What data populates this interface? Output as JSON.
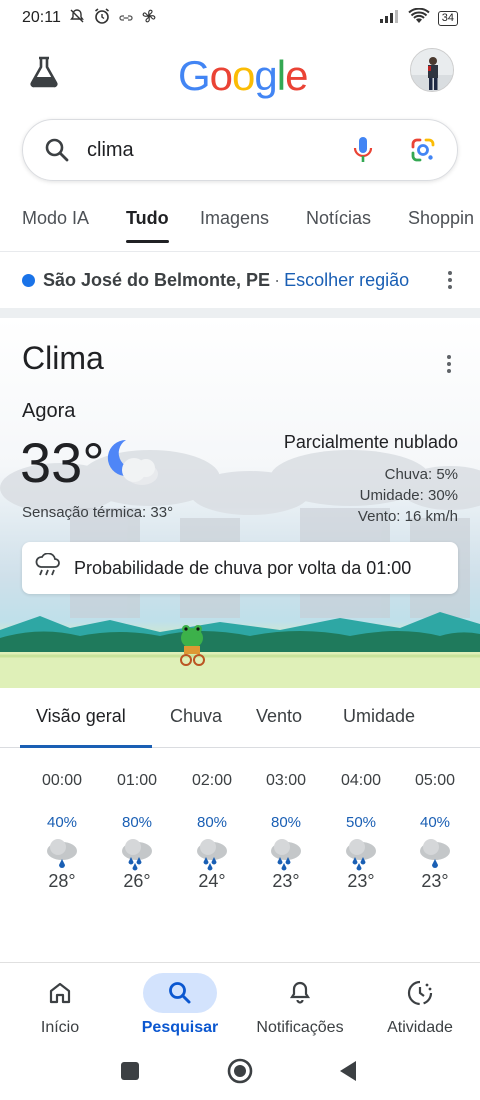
{
  "status_bar": {
    "time": "20:11",
    "battery": "34",
    "left_icons": [
      "bell-off-icon",
      "alarm-icon",
      "link-icon",
      "fan-icon"
    ],
    "right_icons": [
      "signal-icon",
      "wifi-icon",
      "battery-icon"
    ]
  },
  "header": {
    "logo_text": "Google",
    "logo_colors": [
      "#4285F4",
      "#EA4335",
      "#FBBC05",
      "#4285F4",
      "#34A853",
      "#EA4335"
    ]
  },
  "search": {
    "query": "clima"
  },
  "tabs": [
    {
      "label": "Modo IA",
      "active": false
    },
    {
      "label": "Tudo",
      "active": true
    },
    {
      "label": "Imagens",
      "active": false
    },
    {
      "label": "Notícias",
      "active": false
    },
    {
      "label": "Shoppin",
      "active": false
    }
  ],
  "location": {
    "name": "São José do Belmonte, PE",
    "separator": "·",
    "link": "Escolher região"
  },
  "weather": {
    "title": "Clima",
    "now_label": "Agora",
    "temperature": "33°",
    "feels_like": "Sensação térmica: 33°",
    "condition": "Parcialmente nublado",
    "rain": "Chuva: 5%",
    "humidity": "Umidade: 30%",
    "wind": "Vento: 16 km/h",
    "rain_banner": "Probabilidade de chuva por volta da 01:00",
    "view_tabs": [
      "Visão geral",
      "Chuva",
      "Vento",
      "Umidade"
    ]
  },
  "hourly": [
    {
      "time": "00:00",
      "chance": "40%",
      "temp": "28°",
      "icon": "night-rain-icon"
    },
    {
      "time": "01:00",
      "chance": "80%",
      "temp": "26°",
      "icon": "heavy-rain-icon"
    },
    {
      "time": "02:00",
      "chance": "80%",
      "temp": "24°",
      "icon": "heavy-rain-icon"
    },
    {
      "time": "03:00",
      "chance": "80%",
      "temp": "23°",
      "icon": "heavy-rain-icon"
    },
    {
      "time": "04:00",
      "chance": "50%",
      "temp": "23°",
      "icon": "heavy-rain-icon"
    },
    {
      "time": "05:00",
      "chance": "40%",
      "temp": "23°",
      "icon": "light-rain-icon"
    }
  ],
  "bottom_nav": [
    {
      "label": "Início",
      "icon": "home-icon",
      "active": false
    },
    {
      "label": "Pesquisar",
      "icon": "search-icon",
      "active": true
    },
    {
      "label": "Notificações",
      "icon": "bell-icon",
      "active": false
    },
    {
      "label": "Atividade",
      "icon": "activity-icon",
      "active": false
    }
  ]
}
